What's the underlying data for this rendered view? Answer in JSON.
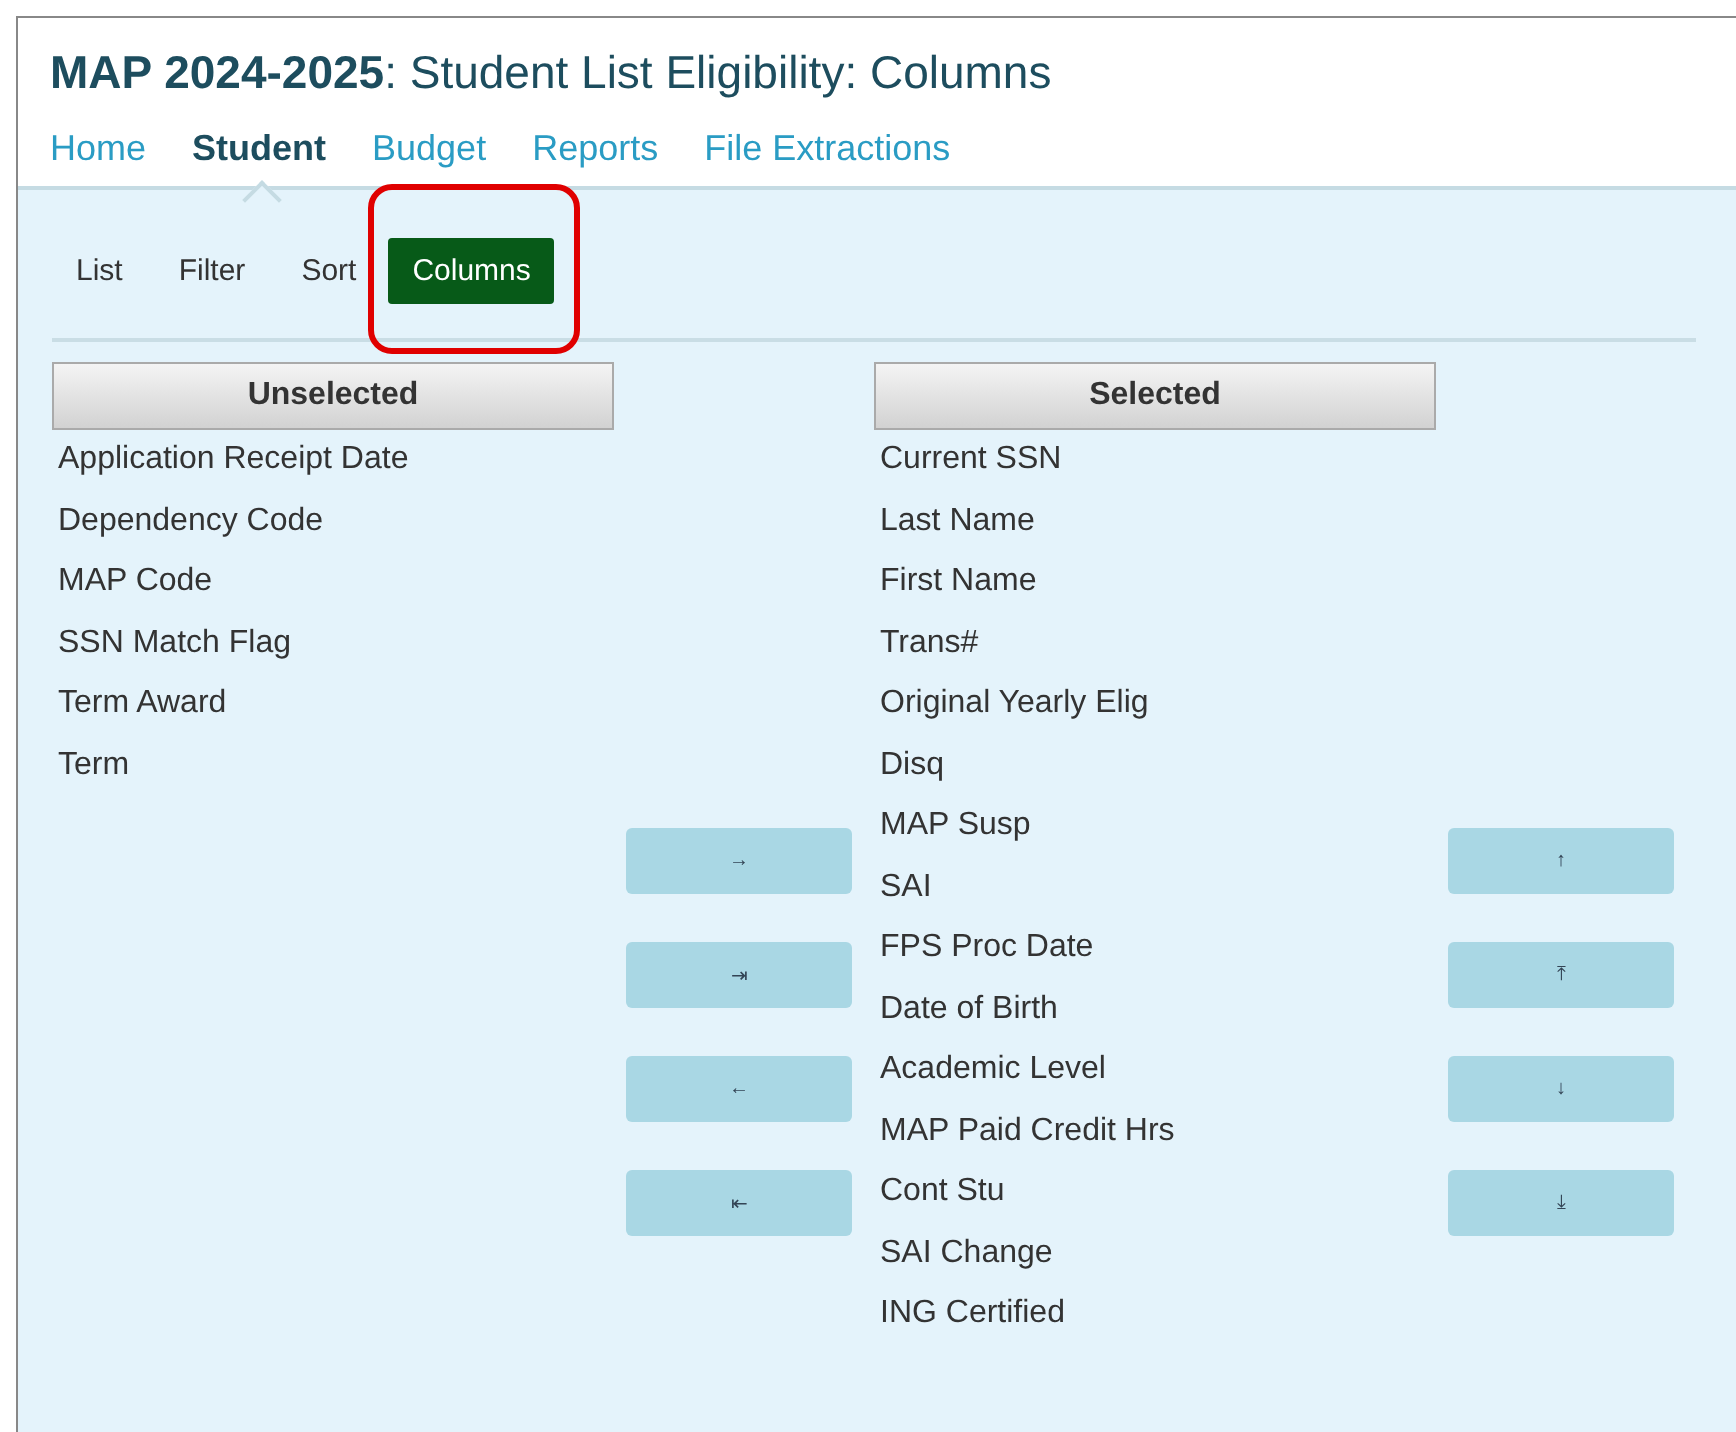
{
  "title": {
    "app": "MAP 2024-2025",
    "page": ": Student List Eligibility: Columns"
  },
  "nav": [
    {
      "label": "Home",
      "selected": false
    },
    {
      "label": "Student",
      "selected": true
    },
    {
      "label": "Budget",
      "selected": false
    },
    {
      "label": "Reports",
      "selected": false
    },
    {
      "label": "File Extractions",
      "selected": false
    }
  ],
  "subnav": [
    {
      "label": "List",
      "selected": false,
      "highlighted": false
    },
    {
      "label": "Filter",
      "selected": false,
      "highlighted": false
    },
    {
      "label": "Sort",
      "selected": false,
      "highlighted": false
    },
    {
      "label": "Columns",
      "selected": true,
      "highlighted": true
    }
  ],
  "unselected": {
    "header": "Unselected",
    "items": [
      "Application Receipt Date",
      "Dependency Code",
      "MAP Code",
      "SSN Match Flag",
      "Term Award",
      "Term"
    ]
  },
  "transfer_buttons": [
    "→",
    "⇥",
    "←",
    "⇤"
  ],
  "selected": {
    "header": "Selected",
    "items": [
      "Current SSN",
      "Last Name",
      "First Name",
      "Trans#",
      "Original Yearly Elig",
      "Disq",
      "MAP Susp",
      "SAI",
      "FPS Proc Date",
      "Date of Birth",
      "Academic Level",
      "MAP Paid Credit Hrs",
      "Cont Stu",
      "SAI Change",
      "ING Certified"
    ]
  },
  "order_buttons": [
    "↑",
    "⤒",
    "↓",
    "⤓"
  ]
}
